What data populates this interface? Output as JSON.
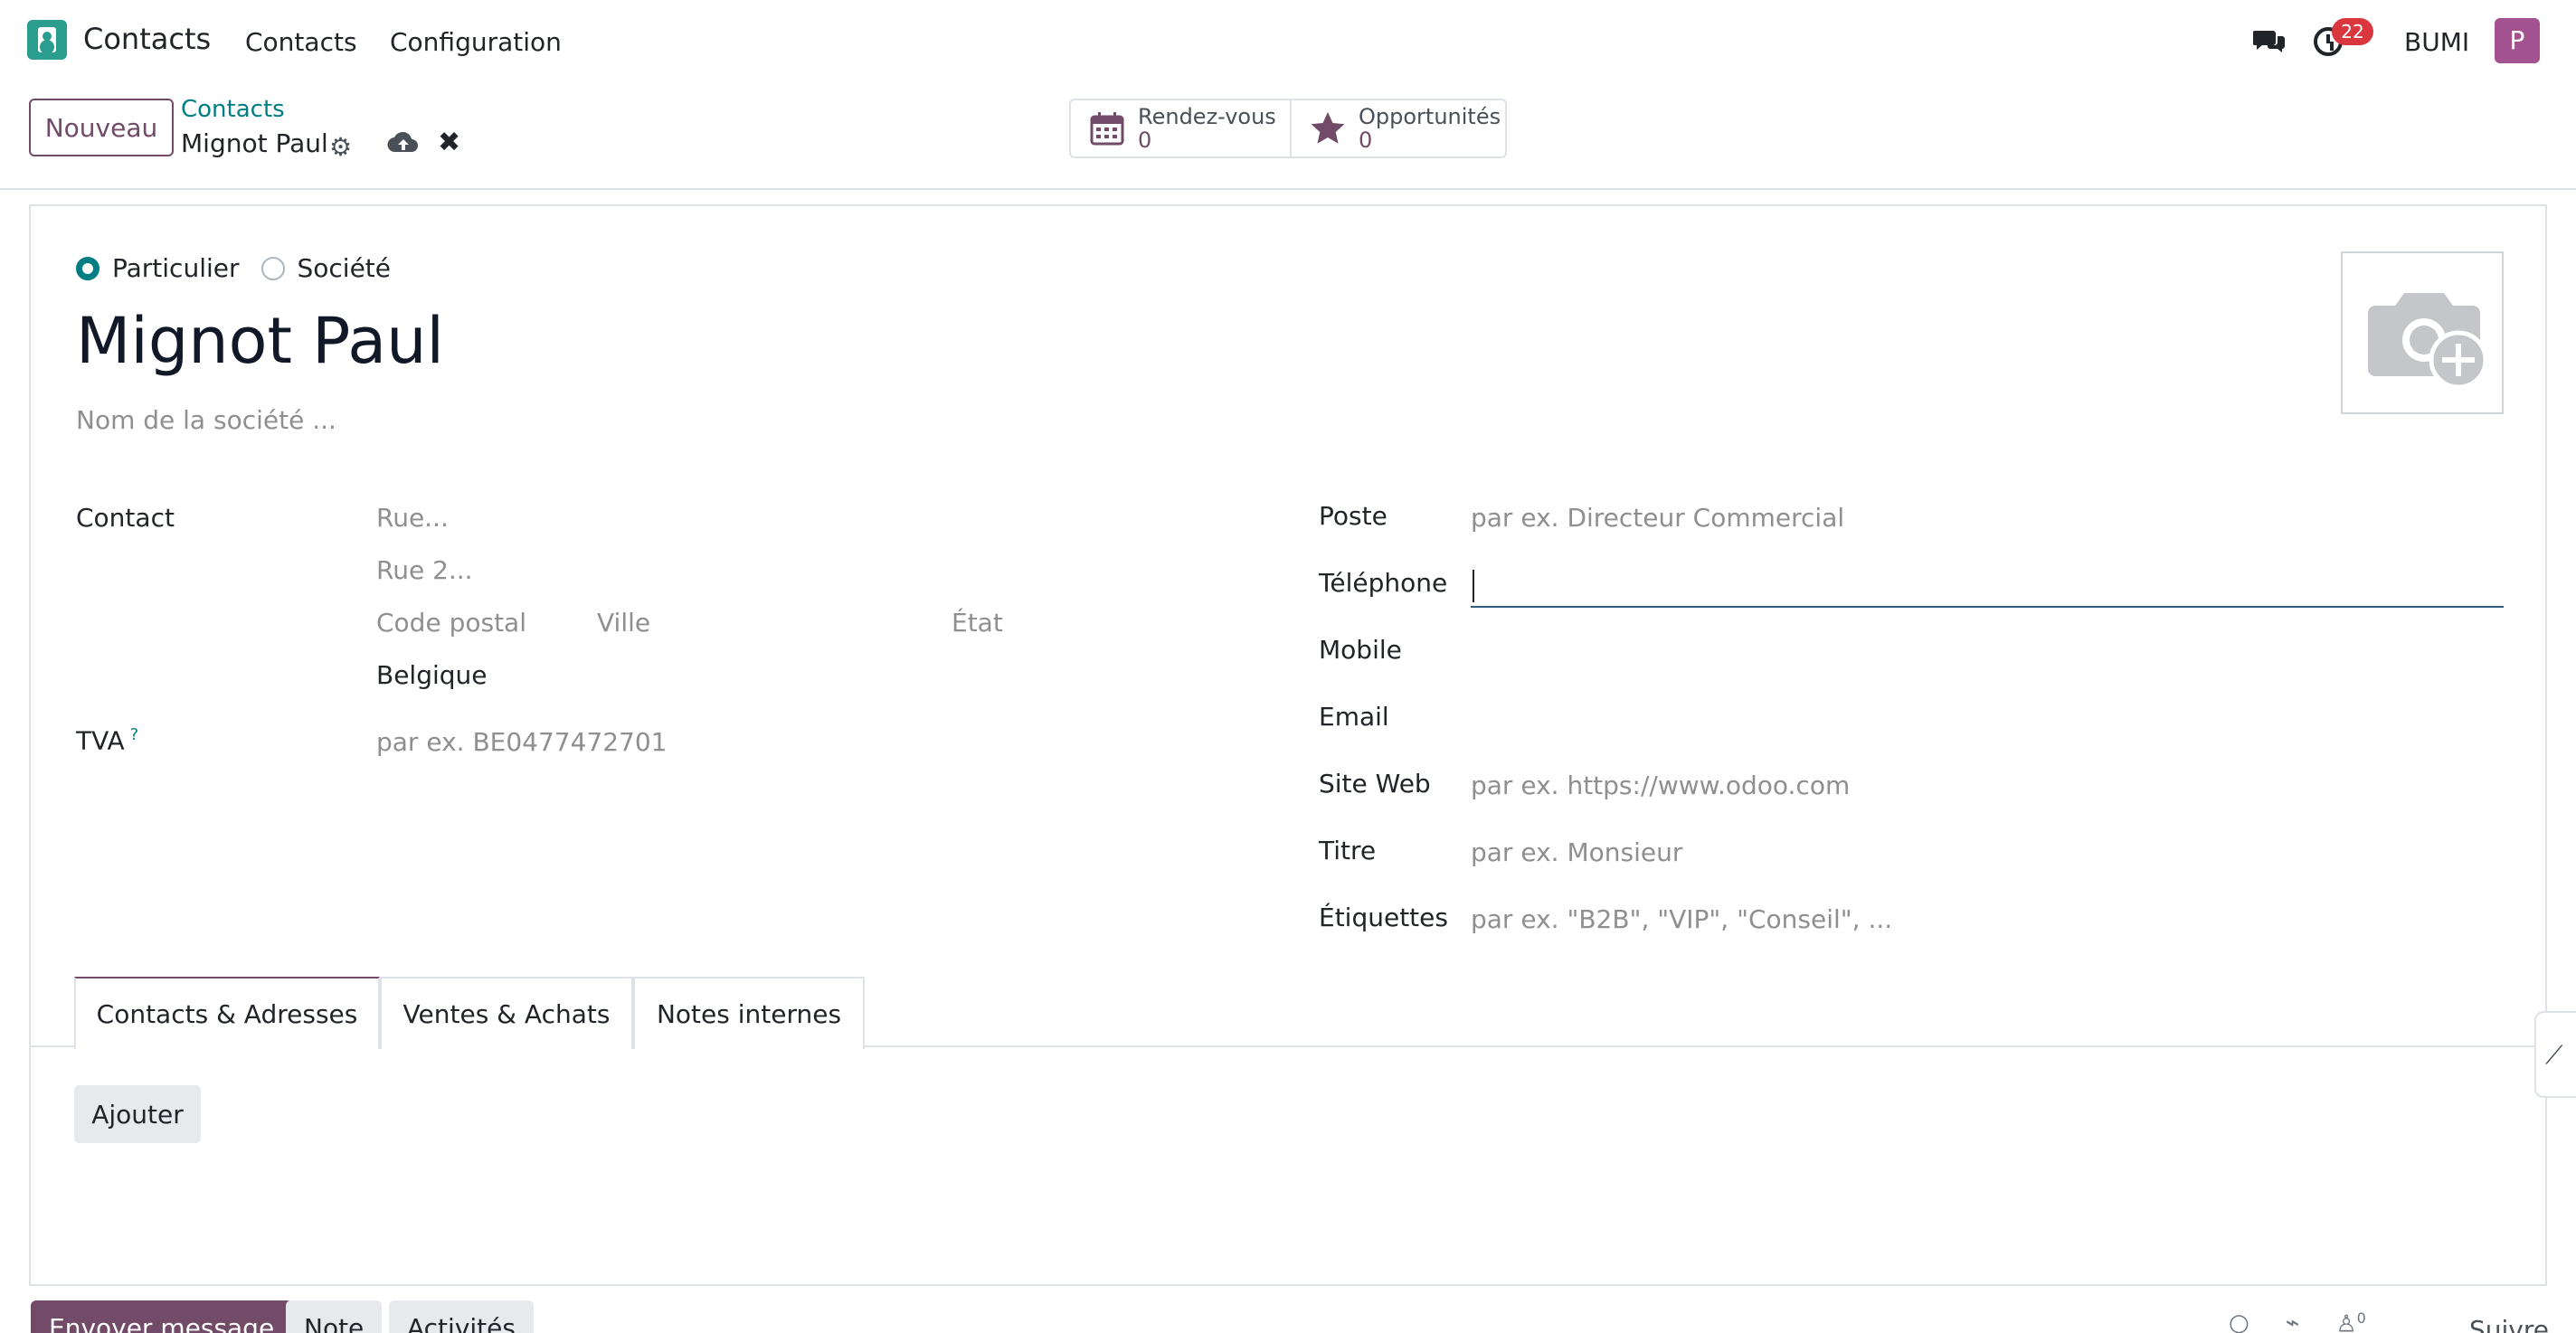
{
  "navbar": {
    "app_name": "Contacts",
    "menu": [
      "Contacts",
      "Configuration"
    ],
    "notification_count": "22",
    "company": "BUMI",
    "avatar_letter": "P"
  },
  "control_panel": {
    "new_button": "Nouveau",
    "breadcrumb_parent": "Contacts",
    "record_name": "Mignot Paul",
    "smart_buttons": [
      {
        "label": "Rendez-vous",
        "value": "0",
        "icon": "calendar-icon"
      },
      {
        "label": "Opportunités",
        "value": "0",
        "icon": "star-icon"
      }
    ]
  },
  "form": {
    "type_options": {
      "individual": "Particulier",
      "company": "Société"
    },
    "name": "Mignot Paul",
    "company_placeholder": "Nom de la société ...",
    "left": {
      "contact_label": "Contact",
      "street_ph": "Rue...",
      "street2_ph": "Rue 2...",
      "zip_ph": "Code postal",
      "city_ph": "Ville",
      "state_ph": "État",
      "country": "Belgique",
      "vat_label": "TVA",
      "vat_help": "?",
      "vat_ph": "par ex. BE0477472701"
    },
    "right": {
      "job_label": "Poste",
      "job_ph": "par ex. Directeur Commercial",
      "phone_label": "Téléphone",
      "mobile_label": "Mobile",
      "email_label": "Email",
      "website_label": "Site Web",
      "website_ph": "par ex. https://www.odoo.com",
      "title_label": "Titre",
      "title_ph": "par ex. Monsieur",
      "tags_label": "Étiquettes",
      "tags_ph": "par ex. \"B2B\", \"VIP\", \"Conseil\", ..."
    },
    "tabs": [
      "Contacts & Adresses",
      "Ventes & Achats",
      "Notes internes"
    ],
    "add_button": "Ajouter"
  },
  "chatter": {
    "send_message": "Envoyer message",
    "note": "Note",
    "activities": "Activités",
    "follower_count": "0",
    "follow": "Suivre"
  },
  "colors": {
    "brand": "#714b67",
    "accent": "#017e84",
    "badge": "#d9363e"
  }
}
